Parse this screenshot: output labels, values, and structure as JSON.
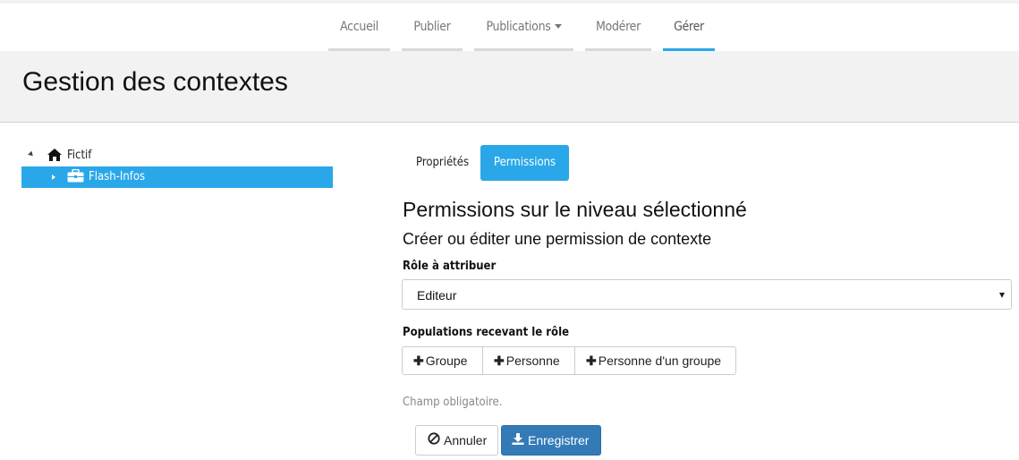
{
  "nav": {
    "items": [
      {
        "label": "Accueil"
      },
      {
        "label": "Publier"
      },
      {
        "label": "Publications"
      },
      {
        "label": "Modérer"
      },
      {
        "label": "Gérer"
      }
    ],
    "active": "Gérer",
    "accent_color": "#2aa7e8"
  },
  "header": {
    "title": "Gestion des contextes"
  },
  "tree": {
    "root": {
      "label": "Fictif",
      "icon": "home-icon"
    },
    "child": {
      "label": "Flash-Infos",
      "icon": "briefcase-icon",
      "selected": true
    }
  },
  "tabs": [
    {
      "label": "Propriétés"
    },
    {
      "label": "Permissions"
    }
  ],
  "active_tab": "Permissions",
  "form": {
    "title": "Permissions sur le niveau sélectionné",
    "subtitle": "Créer ou éditer une permission de contexte",
    "role_label": "Rôle à attribuer",
    "role_value": "Editeur",
    "populations_label": "Populations recevant le rôle",
    "population_buttons": [
      {
        "label": "Groupe"
      },
      {
        "label": "Personne"
      },
      {
        "label": "Personne d'un groupe"
      }
    ],
    "hint": "Champ obligatoire.",
    "cancel_label": "Annuler",
    "save_label": "Enregistrer"
  }
}
